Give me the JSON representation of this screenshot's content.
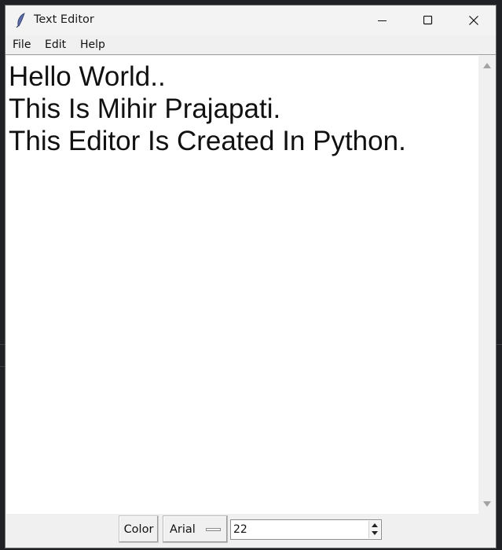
{
  "window": {
    "title": "Text Editor",
    "app_icon": "feather-icon",
    "controls": [
      "minimize-icon",
      "maximize-icon",
      "close-icon"
    ]
  },
  "menu": {
    "items": [
      {
        "label": "File"
      },
      {
        "label": "Edit"
      },
      {
        "label": "Help"
      }
    ]
  },
  "editor": {
    "lines": [
      "Hello World..",
      "This Is Mihir Prajapati.",
      "This Editor Is Created In Python."
    ]
  },
  "toolbar": {
    "color_label": "Color",
    "font_value": "Arial",
    "size_value": "22"
  },
  "colors": {
    "window_bg": "#f0f0f0",
    "text_area_bg": "#ffffff",
    "text_color": "#111111",
    "desktop_bg": "#202124"
  }
}
